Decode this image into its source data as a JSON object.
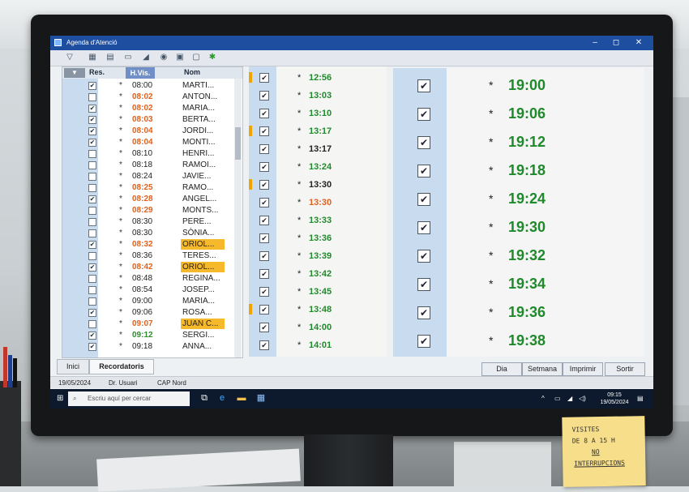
{
  "window": {
    "title": "Agenda d'Atenció",
    "controls": [
      "–",
      "◻",
      "✕"
    ]
  },
  "toolbar": {
    "icons": [
      "filter-icon",
      "calendar-icon",
      "calendar-grid-icon",
      "document-icon",
      "chart-icon",
      "eye-icon",
      "print-icon",
      "copy-icon",
      "refresh-icon"
    ]
  },
  "panel1": {
    "headers": {
      "res": "Res.",
      "hvis": "H.Vis.",
      "nom": "Nom"
    },
    "rows": [
      {
        "checked": true,
        "time": "08:00",
        "color": "#222222",
        "name": "MARTI...",
        "hl": false
      },
      {
        "checked": false,
        "time": "08:02",
        "color": "#e2611c",
        "name": "ANTON...",
        "hl": false
      },
      {
        "checked": true,
        "time": "08:02",
        "color": "#e2611c",
        "name": "MARIA...",
        "hl": false
      },
      {
        "checked": true,
        "time": "08:03",
        "color": "#e2611c",
        "name": "BERTA...",
        "hl": false
      },
      {
        "checked": true,
        "time": "08:04",
        "color": "#e2611c",
        "name": "JORDI...",
        "hl": false
      },
      {
        "checked": true,
        "time": "08:04",
        "color": "#e2611c",
        "name": "MONTI...",
        "hl": false
      },
      {
        "checked": false,
        "time": "08:10",
        "color": "#222222",
        "name": "HENRI...",
        "hl": false
      },
      {
        "checked": false,
        "time": "08:18",
        "color": "#222222",
        "name": "RAMOI...",
        "hl": false
      },
      {
        "checked": false,
        "time": "08:24",
        "color": "#222222",
        "name": "JAVIE...",
        "hl": false
      },
      {
        "checked": false,
        "time": "08:25",
        "color": "#e2611c",
        "name": "RAMO...",
        "hl": false
      },
      {
        "checked": true,
        "time": "08:28",
        "color": "#e2611c",
        "name": "ANGEL...",
        "hl": false
      },
      {
        "checked": false,
        "time": "08:29",
        "color": "#e2611c",
        "name": "MONTS...",
        "hl": false
      },
      {
        "checked": false,
        "time": "08:30",
        "color": "#222222",
        "name": "PERE...",
        "hl": false
      },
      {
        "checked": false,
        "time": "08:30",
        "color": "#222222",
        "name": "SÒNIA...",
        "hl": false
      },
      {
        "checked": true,
        "time": "08:32",
        "color": "#e2611c",
        "name": "ORIOL...",
        "hl": true
      },
      {
        "checked": false,
        "time": "08:36",
        "color": "#222222",
        "name": "TERES...",
        "hl": false
      },
      {
        "checked": true,
        "time": "08:42",
        "color": "#e2611c",
        "name": "ORIOL...",
        "hl": true
      },
      {
        "checked": false,
        "time": "08:48",
        "color": "#222222",
        "name": "REGINA...",
        "hl": false
      },
      {
        "checked": false,
        "time": "08:54",
        "color": "#222222",
        "name": "JOSEP...",
        "hl": false
      },
      {
        "checked": false,
        "time": "09:00",
        "color": "#222222",
        "name": "MARIA...",
        "hl": false
      },
      {
        "checked": true,
        "time": "09:06",
        "color": "#222222",
        "name": "ROSA...",
        "hl": false
      },
      {
        "checked": false,
        "time": "09:07",
        "color": "#e2611c",
        "name": "JUAN C...",
        "hl": true
      },
      {
        "checked": true,
        "time": "09:12",
        "color": "#2e8b2e",
        "name": "SERGI...",
        "hl": false
      },
      {
        "checked": true,
        "time": "09:18",
        "color": "#222222",
        "name": "ANNA...",
        "hl": false
      }
    ]
  },
  "panel2": {
    "rows": [
      {
        "mark": true,
        "time": "12:56",
        "color": "#1f8a2b"
      },
      {
        "mark": false,
        "time": "13:03",
        "color": "#1f8a2b"
      },
      {
        "mark": false,
        "time": "13:10",
        "color": "#1f8a2b"
      },
      {
        "mark": true,
        "time": "13:17",
        "color": "#1f8a2b"
      },
      {
        "mark": false,
        "time": "13:17",
        "color": "#222222"
      },
      {
        "mark": false,
        "time": "13:24",
        "color": "#1f8a2b"
      },
      {
        "mark": true,
        "time": "13:30",
        "color": "#222222"
      },
      {
        "mark": false,
        "time": "13:30",
        "color": "#e2611c"
      },
      {
        "mark": false,
        "time": "13:33",
        "color": "#1f8a2b"
      },
      {
        "mark": false,
        "time": "13:36",
        "color": "#1f8a2b"
      },
      {
        "mark": false,
        "time": "13:39",
        "color": "#1f8a2b"
      },
      {
        "mark": false,
        "time": "13:42",
        "color": "#1f8a2b"
      },
      {
        "mark": false,
        "time": "13:45",
        "color": "#1f8a2b"
      },
      {
        "mark": true,
        "time": "13:48",
        "color": "#1f8a2b"
      },
      {
        "mark": false,
        "time": "14:00",
        "color": "#1f8a2b"
      },
      {
        "mark": false,
        "time": "14:01",
        "color": "#1f8a2b"
      }
    ]
  },
  "panel3": {
    "times": [
      "19:00",
      "19:06",
      "19:12",
      "19:18",
      "19:24",
      "19:30",
      "19:32",
      "19:34",
      "19:36",
      "19:38"
    ]
  },
  "tabs": {
    "inici": "Inici",
    "recordatoris": "Recordatoris"
  },
  "buttons": {
    "dia": "Dia",
    "setmana": "Setmana",
    "imprimir": "Imprimir",
    "sortir": "Sortir"
  },
  "status": {
    "date": "19/05/2024",
    "user": "Dr. Usuari",
    "center": "CAP Nord"
  },
  "taskbar": {
    "search_placeholder": "Escriu aquí per cercar",
    "time": "09:15",
    "date": "19/05/2024"
  },
  "sticky": {
    "line1": "Visites",
    "line2": "de 8 a 15 h",
    "line3": "No",
    "line4": "interrupcions"
  }
}
